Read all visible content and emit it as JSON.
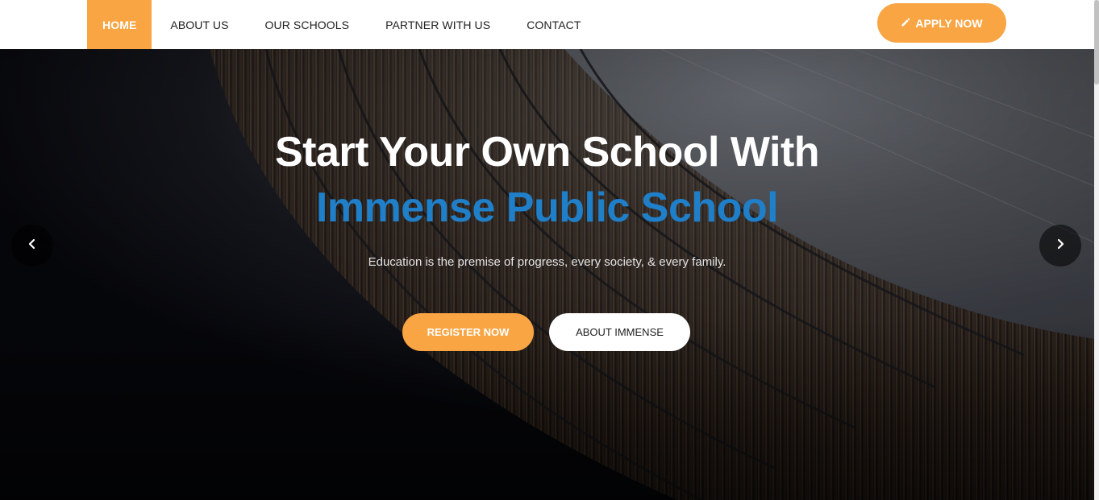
{
  "nav": {
    "items": [
      {
        "label": "HOME",
        "active": true
      },
      {
        "label": "ABOUT US"
      },
      {
        "label": "OUR SCHOOLS"
      },
      {
        "label": "PARTNER WITH US"
      },
      {
        "label": "CONTACT"
      }
    ],
    "apply_label": "APPLY NOW",
    "apply_icon": "pencil-icon"
  },
  "hero": {
    "title_line1": "Start Your Own School With",
    "title_line2": "Immense Public School",
    "subtitle": "Education is the premise of progress, every society, & every family.",
    "register_label": "REGISTER NOW",
    "about_label": "ABOUT IMMENSE",
    "prev_icon": "chevron-left-icon",
    "next_icon": "chevron-right-icon"
  },
  "colors": {
    "accent": "#f9a543",
    "brand_blue": "#1f7fc9"
  }
}
